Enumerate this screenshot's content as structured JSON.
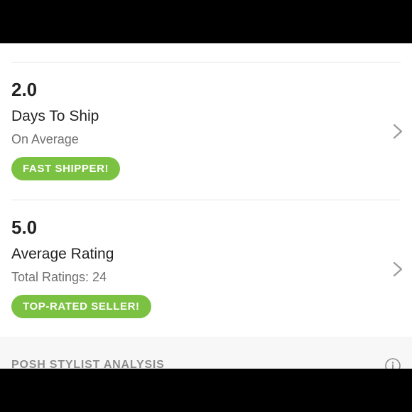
{
  "shipping": {
    "value": "2.0",
    "label": "Days To Ship",
    "sub": "On Average",
    "badge": "FAST SHIPPER!"
  },
  "rating": {
    "value": "5.0",
    "label": "Average Rating",
    "sub": "Total Ratings: 24",
    "badge": "TOP-RATED SELLER!"
  },
  "analysis": {
    "title": "POSH STYLIST ANALYSIS",
    "icon": "info-icon"
  },
  "colors": {
    "badge_green": "#7cc242",
    "text_dark": "#222222",
    "text_muted": "#707070",
    "section_bg": "#f7f7f7"
  }
}
